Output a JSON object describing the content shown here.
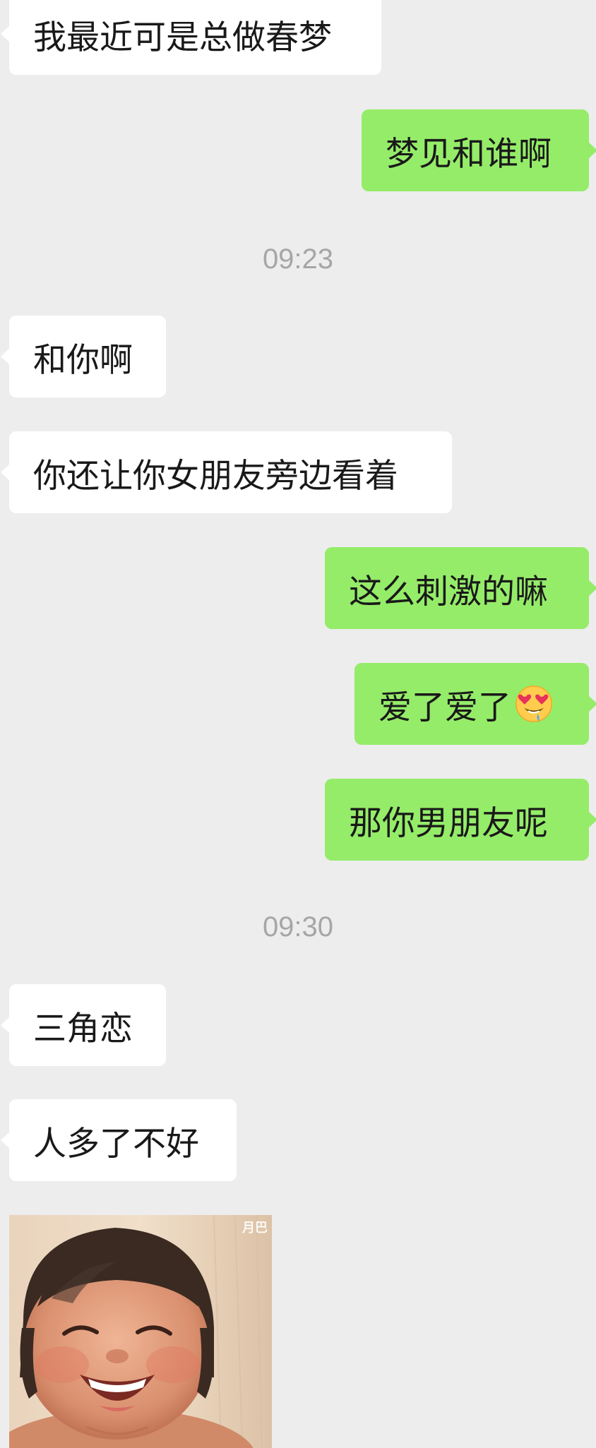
{
  "messages": [
    {
      "side": "left",
      "text": "我最近可是总做春梦"
    },
    {
      "side": "right",
      "text": "梦见和谁啊"
    },
    {
      "type": "time",
      "text": "09:23"
    },
    {
      "side": "left",
      "text": "和你啊"
    },
    {
      "side": "left",
      "text": "你还让你女朋友旁边看着"
    },
    {
      "side": "right",
      "text": "这么刺激的嘛"
    },
    {
      "side": "right",
      "text": "爱了爱了",
      "emoji": "heart-eyes-drooling-emoji"
    },
    {
      "side": "right",
      "text": "那你男朋友呢"
    },
    {
      "type": "time",
      "text": "09:30"
    },
    {
      "side": "left",
      "text": "三角恋"
    },
    {
      "side": "left",
      "text": "人多了不好"
    },
    {
      "side": "left",
      "type": "sticker",
      "subject": "laughing-baby-sticker",
      "watermark": "月巴"
    }
  ],
  "colors": {
    "background": "#ededed",
    "incoming_bubble": "#ffffff",
    "outgoing_bubble": "#95ec69",
    "text": "#191919",
    "timestamp": "#a6a6a6"
  }
}
